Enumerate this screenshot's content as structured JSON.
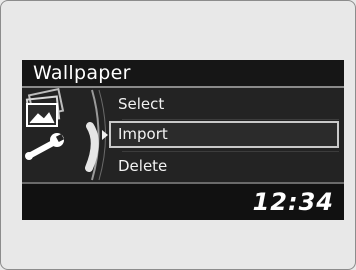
{
  "screen": {
    "title": "Wallpaper",
    "clock": "12:34"
  },
  "menu": {
    "items": [
      {
        "label": "Select"
      },
      {
        "label": "Import"
      },
      {
        "label": "Delete"
      }
    ],
    "selected_label": "Import"
  },
  "icons": {
    "left_icon": "wallpaper-settings-icon",
    "selection_indicator": "selection-arrow-icon"
  },
  "colors": {
    "screen_background": "#1a1a1a",
    "panel_background": "#232323",
    "text": "#f2f2f2",
    "highlight_border": "#c9c9c9",
    "page_background": "#e8e8e8"
  }
}
